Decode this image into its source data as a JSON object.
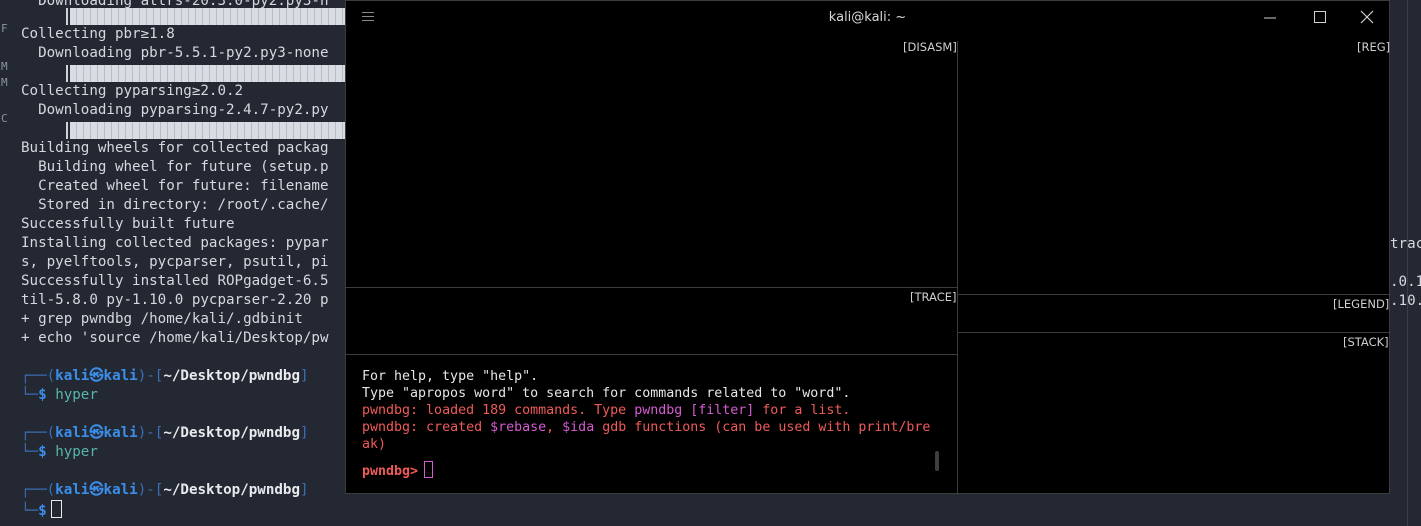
{
  "background_terminal": {
    "lines": [
      "  Downloading attrs-20.3.0-py2.py3-n",
      "Collecting pbr≥1.8",
      "  Downloading pbr-5.5.1-py2.py3-none",
      "Collecting pyparsing≥2.0.2",
      "  Downloading pyparsing-2.4.7-py2.py",
      "Building wheels for collected packag",
      "  Building wheel for future (setup.p",
      "  Created wheel for future: filename",
      "  Stored in directory: /root/.cache/",
      "Successfully built future",
      "Installing collected packages: pypar",
      "s, pyelftools, pycparser, psutil, pi",
      "Successfully installed ROPgadget-6.5",
      "til-5.8.0 py-1.10.0 pycparser-2.20 p",
      "+ grep pwndbg /home/kali/.gdbinit",
      "+ echo 'source /home/kali/Desktop/pw"
    ],
    "prompt_user": "kali",
    "prompt_at": "㉿",
    "prompt_host": "kali",
    "prompt_path": "~/Desktop/pwndbg",
    "prompt_dollar": "$",
    "prompts": [
      {
        "command": "hyper"
      },
      {
        "command": "hyper"
      },
      {
        "command": ""
      }
    ],
    "right_fragments": [
      "trac",
      ".0.1",
      ".10."
    ],
    "left_fragments": [
      "F",
      "M",
      "M",
      "C"
    ]
  },
  "hyper_window": {
    "title": "kali@kali: ~",
    "panes": {
      "disasm": "[DISASM]",
      "reg": "[REG]",
      "trace": "[TRACE]",
      "legend": "[LEGEND]",
      "stack": "[STACK]"
    },
    "gdb_output": {
      "line1": "For help, type \"help\".",
      "line2": "Type \"apropos word\" to search for commands related to \"word\".",
      "line3_label": "pwndbg:",
      "line3_text_a": " loaded 189 commands. Type ",
      "line3_cmd": "pwndbg [filter]",
      "line3_text_b": " for a list.",
      "line4_label": "pwndbg:",
      "line4_text_a": " created ",
      "line4_rebase": "$rebase",
      "line4_comma": ", ",
      "line4_ida": "$ida",
      "line4_text_b": " gdb functions (can be used with print/bre",
      "line5": "ak)",
      "prompt": "pwndbg>"
    }
  },
  "colors": {
    "bg_terminal": "#242833",
    "prompt_blue": "#3b8eea",
    "pwndbg_red": "#f05a5a",
    "pwndbg_magenta": "#d45bd0"
  }
}
